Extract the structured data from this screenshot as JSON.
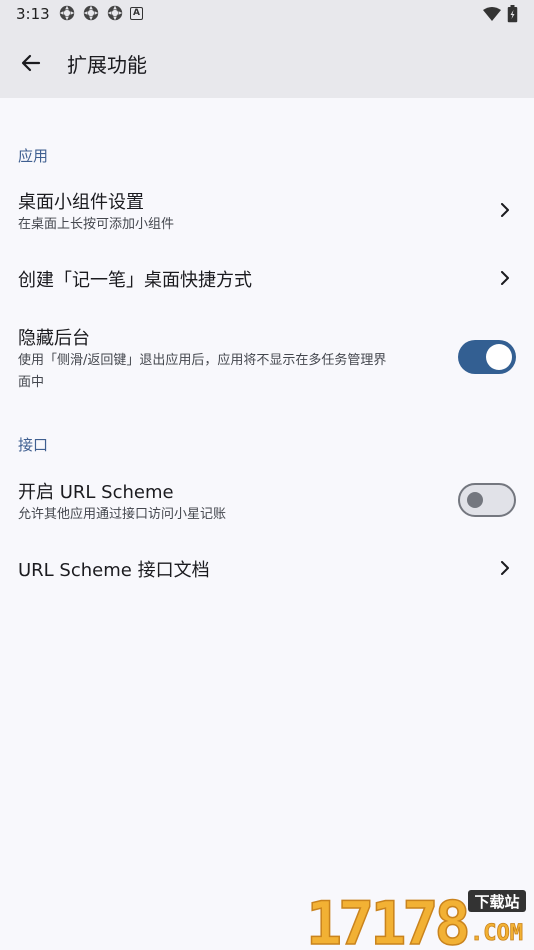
{
  "status": {
    "time": "3:13"
  },
  "appbar": {
    "title": "扩展功能"
  },
  "sections": [
    {
      "header": "应用",
      "items": [
        {
          "title": "桌面小组件设置",
          "subtitle": "在桌面上长按可添加小组件",
          "control": "chevron-right-icon"
        },
        {
          "title": "创建「记一笔」桌面快捷方式",
          "control": "chevron-right-icon"
        },
        {
          "title": "隐藏后台",
          "subtitle_line1": "使用「侧滑/返回键」退出应用后，应用将不显示在多任务管理界",
          "subtitle_line2": "面中",
          "control": "switch",
          "checked": true
        }
      ]
    },
    {
      "header": "接口",
      "items": [
        {
          "title": "开启 URL Scheme",
          "subtitle": "允许其他应用通过接口访问小星记账",
          "control": "switch",
          "checked": false
        },
        {
          "title": "URL Scheme 接口文档",
          "control": "chevron-right-icon"
        }
      ]
    }
  ],
  "watermark": {
    "digits": "17178",
    "tag": "下载站",
    "domain": ".COM"
  },
  "colors": {
    "accent": "#335f92",
    "section_header": "#3f5f90",
    "background": "#f8f8fc",
    "appbar": "#e8e8ec"
  }
}
